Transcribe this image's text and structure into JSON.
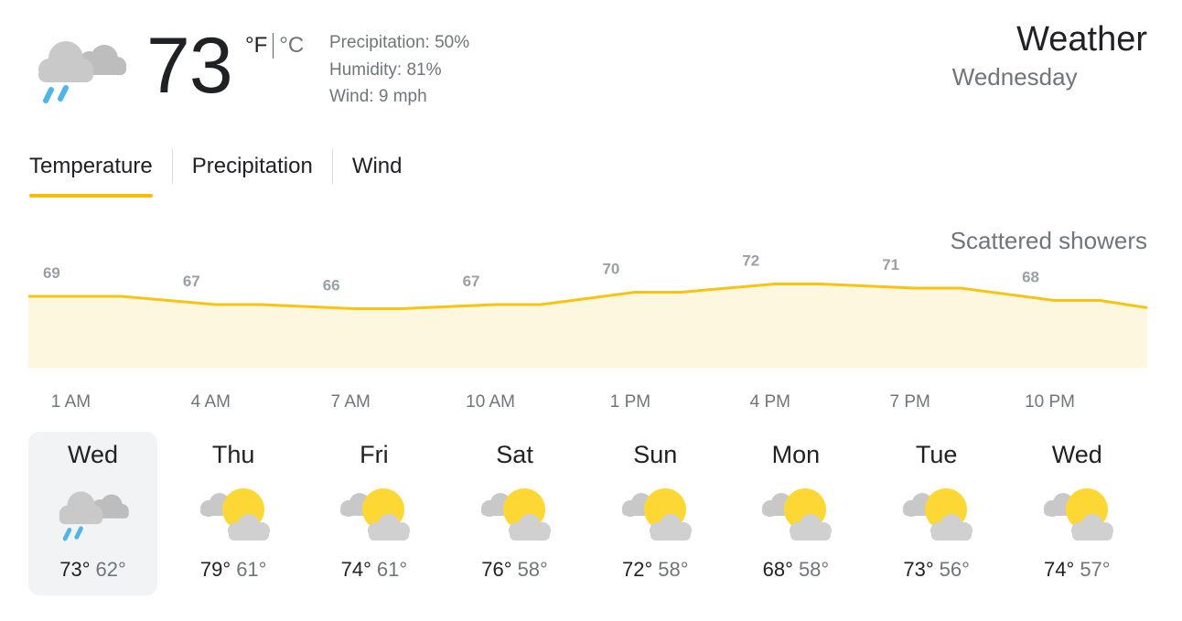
{
  "current": {
    "icon": "rain-cloud-icon",
    "temperature": "73",
    "unit_f": "°F",
    "unit_c": "°C",
    "precipitation": "Precipitation: 50%",
    "humidity": "Humidity: 81%",
    "wind": "Wind: 9 mph"
  },
  "header": {
    "title": "Weather",
    "day": "Wednesday",
    "condition": "Scattered showers"
  },
  "tabs": [
    {
      "label": "Temperature",
      "active": true
    },
    {
      "label": "Precipitation",
      "active": false
    },
    {
      "label": "Wind",
      "active": false
    }
  ],
  "colors": {
    "accent": "#fbbc04",
    "chart_line": "#f9c411",
    "chart_fill": "#fef7e0",
    "rain": "#4fb5e8",
    "cloud": "#c8c8c8",
    "sun": "#fdd835",
    "selected_bg": "#f1f3f4"
  },
  "chart_data": {
    "type": "area",
    "x": [
      "1 AM",
      "4 AM",
      "7 AM",
      "10 AM",
      "1 PM",
      "4 PM",
      "7 PM",
      "10 PM"
    ],
    "values": [
      69,
      67,
      66,
      67,
      70,
      72,
      71,
      68
    ],
    "xlabel": "",
    "ylabel": ""
  },
  "forecast": [
    {
      "day": "Wed",
      "icon": "rain-cloud-icon",
      "high": "73°",
      "low": "62°",
      "selected": true
    },
    {
      "day": "Thu",
      "icon": "partly-cloudy-icon",
      "high": "79°",
      "low": "61°",
      "selected": false
    },
    {
      "day": "Fri",
      "icon": "partly-cloudy-icon",
      "high": "74°",
      "low": "61°",
      "selected": false
    },
    {
      "day": "Sat",
      "icon": "partly-cloudy-icon",
      "high": "76°",
      "low": "58°",
      "selected": false
    },
    {
      "day": "Sun",
      "icon": "partly-cloudy-icon",
      "high": "72°",
      "low": "58°",
      "selected": false
    },
    {
      "day": "Mon",
      "icon": "partly-cloudy-icon",
      "high": "68°",
      "low": "58°",
      "selected": false
    },
    {
      "day": "Tue",
      "icon": "partly-cloudy-icon",
      "high": "73°",
      "low": "56°",
      "selected": false
    },
    {
      "day": "Wed",
      "icon": "partly-cloudy-icon",
      "high": "74°",
      "low": "57°",
      "selected": false
    }
  ]
}
